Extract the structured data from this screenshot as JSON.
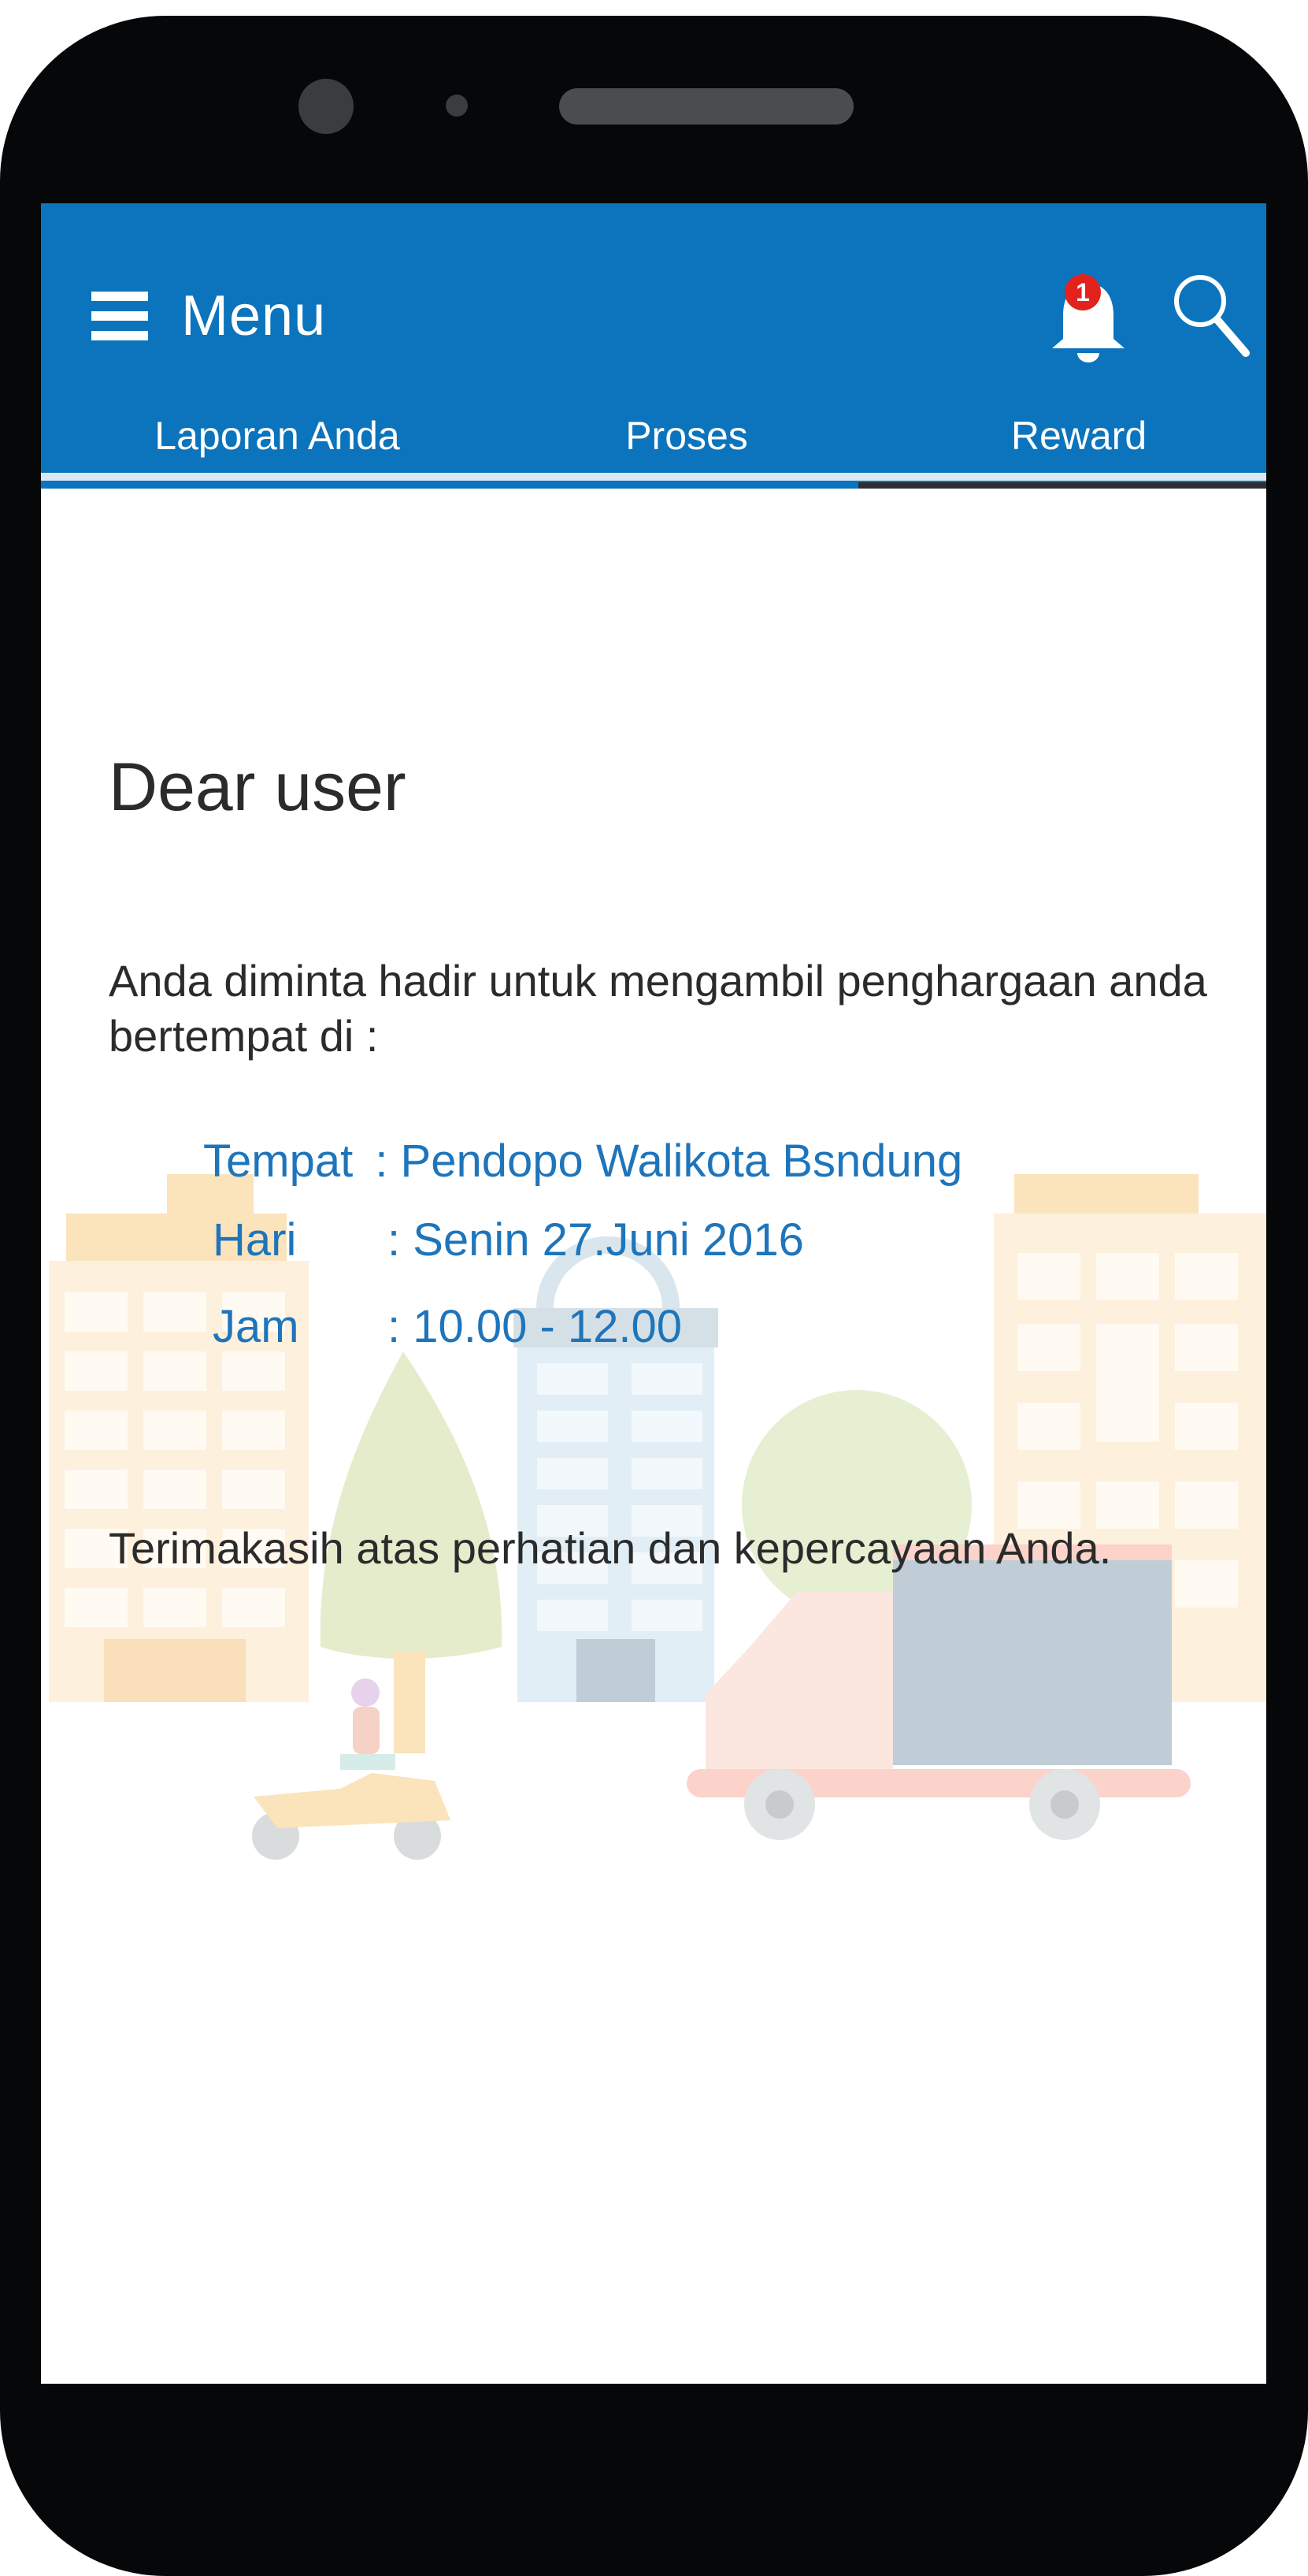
{
  "app_bar": {
    "menu_label": "Menu",
    "notification_count": "1",
    "color": "#0b74bc"
  },
  "tabs": [
    {
      "label": "Laporan Anda"
    },
    {
      "label": "Proses"
    },
    {
      "label": "Reward"
    }
  ],
  "active_tab": "Proses",
  "message": {
    "greeting": "Dear user",
    "intro": "Anda diminta hadir untuk mengambil penghargaan anda bertempat di :",
    "details": [
      {
        "label": "Tempat",
        "value": ": Pendopo Walikota Bsndung"
      },
      {
        "label": "Hari",
        "value": ": Senin 27.Juni 2016"
      },
      {
        "label": "Jam",
        "value": ": 10.00 - 12.00"
      }
    ],
    "closing": "Terimakasih atas perhatian dan kepercayaan Anda."
  },
  "icons": [
    "hamburger-icon",
    "bell-icon",
    "search-icon"
  ]
}
